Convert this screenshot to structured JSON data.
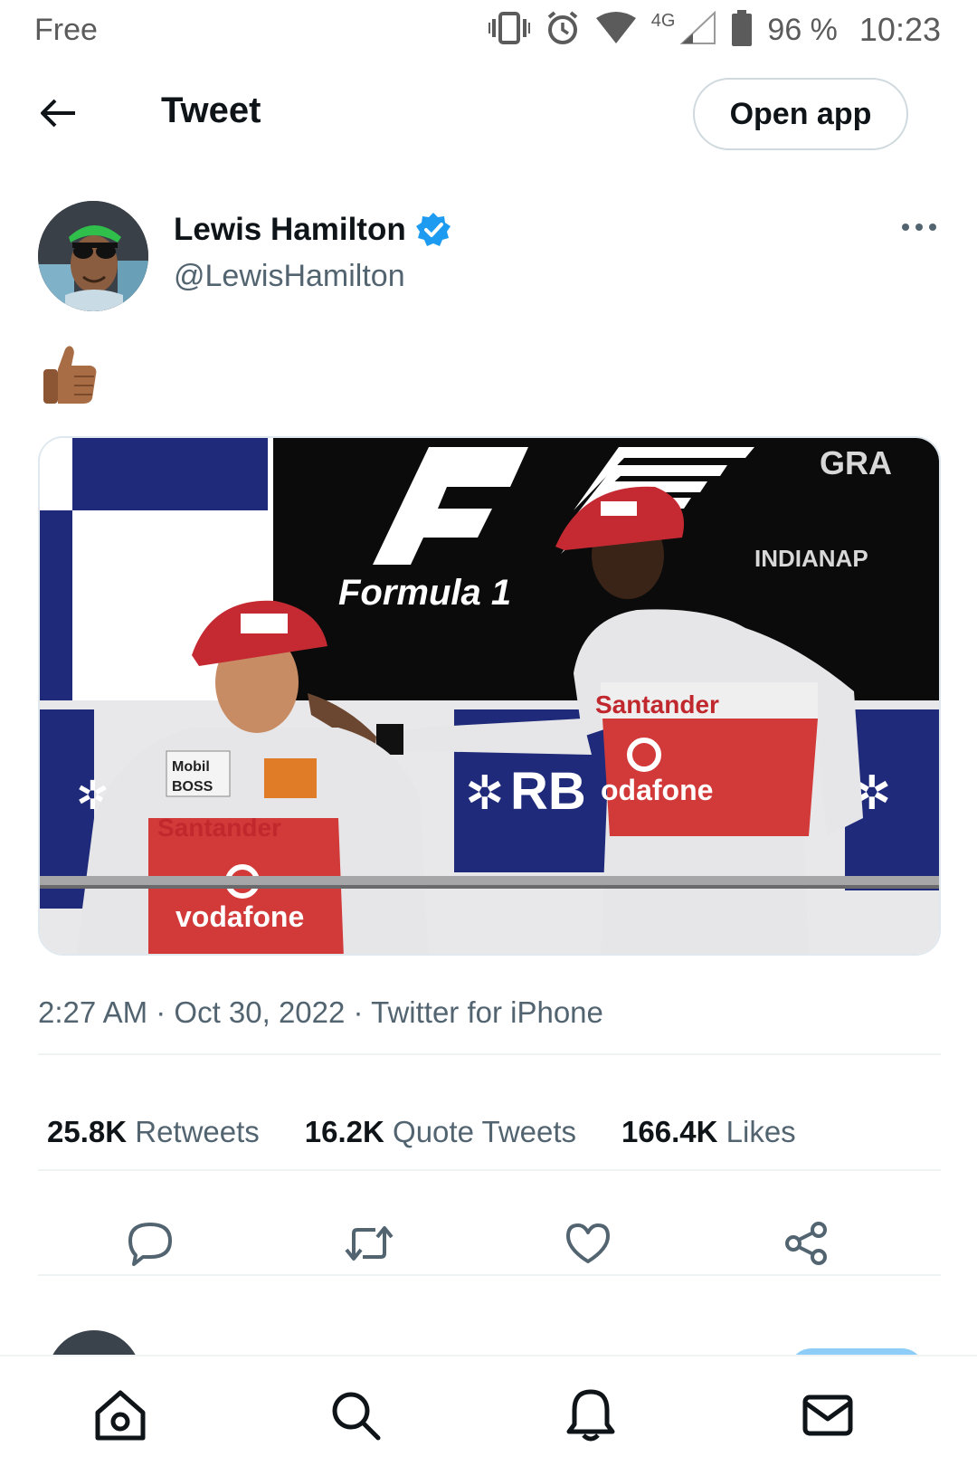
{
  "status_bar": {
    "carrier": "Free",
    "network": "4G",
    "battery": "96 %",
    "time": "10:23",
    "icons": [
      "vibrate-icon",
      "alarm-icon",
      "wifi-icon",
      "signal-icon",
      "battery-icon"
    ]
  },
  "header": {
    "title": "Tweet",
    "open_app_label": "Open app",
    "back_icon": "arrow-left-icon"
  },
  "author": {
    "name": "Lewis Hamilton",
    "handle": "@LewisHamilton",
    "verified": true
  },
  "tweet": {
    "text": "👍🏽",
    "media": {
      "logo_text": "Formula 1",
      "banner_top_right": "GRA",
      "banner_right": "INDIANAP",
      "sponsor_left_1": "Santander",
      "sponsor_left_2": "vodafone",
      "sponsor_right_1": "Santander",
      "sponsor_right_2": "odafone",
      "board_text": "RB",
      "left_chest_1": "Mobil",
      "left_chest_2": "BOSS"
    },
    "time": "2:27 AM",
    "date": "Oct 30, 2022",
    "source": "Twitter for iPhone",
    "separator": " · "
  },
  "stats": {
    "retweets": {
      "value": "25.8K",
      "label": "Retweets"
    },
    "quotes": {
      "value": "16.2K",
      "label": "Quote Tweets"
    },
    "likes": {
      "value": "166.4K",
      "label": "Likes"
    }
  },
  "actions": [
    "reply-icon",
    "retweet-icon",
    "like-icon",
    "share-icon"
  ],
  "bottom_nav": [
    "home-icon",
    "search-icon",
    "notifications-icon",
    "messages-icon"
  ],
  "colors": {
    "verified_blue": "#1d9bf0",
    "text_primary": "#0f1419",
    "text_secondary": "#536471",
    "border": "#cfd9de"
  }
}
